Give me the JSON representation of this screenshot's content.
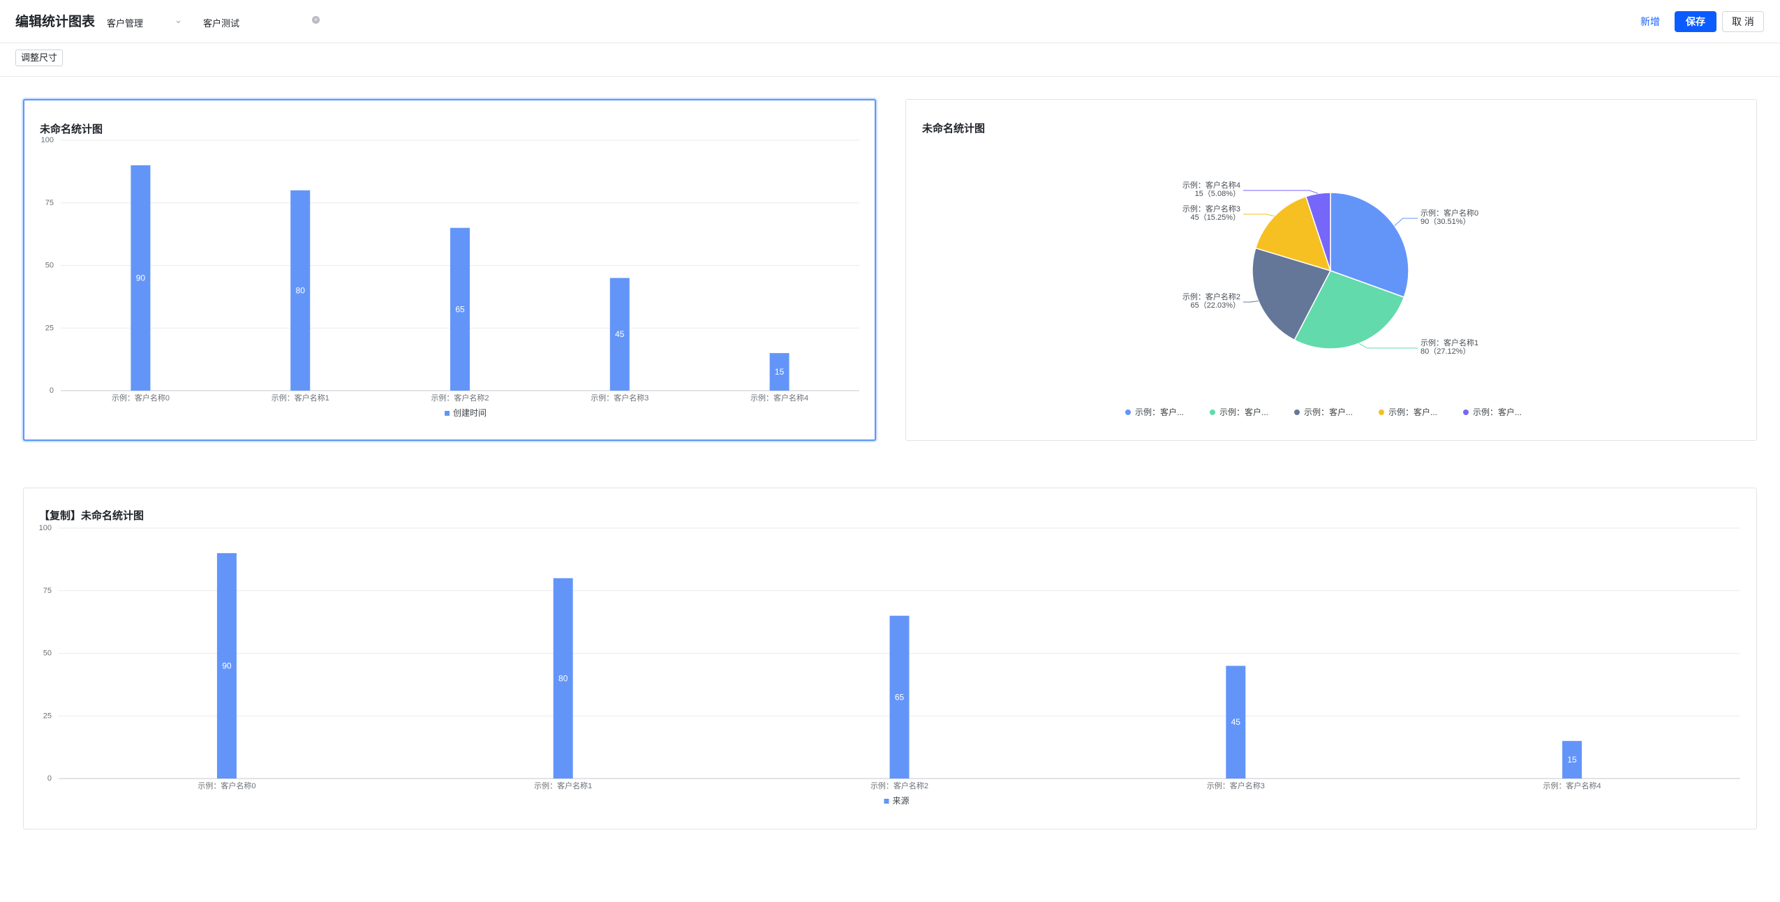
{
  "header": {
    "title": "编辑统计图表",
    "module_select": "客户管理",
    "name_input": "客户测试",
    "add_label": "新增",
    "save_label": "保存",
    "cancel_label": "取 消"
  },
  "toolbar": {
    "resize_label": "调整尺寸"
  },
  "colors": {
    "accent": "#0a5cff",
    "bar": "#6395f9",
    "pie": [
      "#6395f9",
      "#62daab",
      "#657798",
      "#f6c022",
      "#7666f9"
    ]
  },
  "icons": {
    "select_chevron": "chevron-down-icon",
    "clear": "clear-icon",
    "legend_square": "square-icon",
    "legend_dot": "dot-icon"
  },
  "charts": {
    "bar1": {
      "title": "未命名统计图",
      "legend_label": "创建时间",
      "legend_icon": "■"
    },
    "pie": {
      "title": "未命名统计图"
    },
    "bar2": {
      "title": "【复制】未命名统计图",
      "legend_label": "来源",
      "legend_icon": "■"
    }
  },
  "chart_data": [
    {
      "type": "bar",
      "title": "未命名统计图",
      "categories": [
        "示例：客户名称0",
        "示例：客户名称1",
        "示例：客户名称2",
        "示例：客户名称3",
        "示例：客户名称4"
      ],
      "series": [
        {
          "name": "创建时间",
          "values": [
            90,
            80,
            65,
            45,
            15
          ]
        }
      ],
      "ylim": [
        0,
        100
      ],
      "yticks": [
        "0",
        "25",
        "50",
        "75",
        "100"
      ],
      "grid": true,
      "legend": "bottom"
    },
    {
      "type": "pie",
      "title": "未命名统计图",
      "labels": [
        "示例：客户名称0",
        "示例：客户名称1",
        "示例：客户名称2",
        "示例：客户名称3",
        "示例：客户名称4"
      ],
      "values": [
        90,
        80,
        65,
        45,
        15
      ],
      "value_labels": [
        "90（30.51%）",
        "80（27.12%）",
        "65（22.03%）",
        "45（15.25%）",
        "15（5.08%）"
      ],
      "legend_labels": [
        "示例：客户...",
        "示例：客户...",
        "示例：客户...",
        "示例：客户...",
        "示例：客户..."
      ],
      "legend": "bottom"
    },
    {
      "type": "bar",
      "title": "【复制】未命名统计图",
      "categories": [
        "示例：客户名称0",
        "示例：客户名称1",
        "示例：客户名称2",
        "示例：客户名称3",
        "示例：客户名称4"
      ],
      "series": [
        {
          "name": "来源",
          "values": [
            90,
            80,
            65,
            45,
            15
          ]
        }
      ],
      "ylim": [
        0,
        100
      ],
      "yticks": [
        "0",
        "25",
        "50",
        "75",
        "100"
      ],
      "grid": true,
      "legend": "bottom"
    }
  ]
}
